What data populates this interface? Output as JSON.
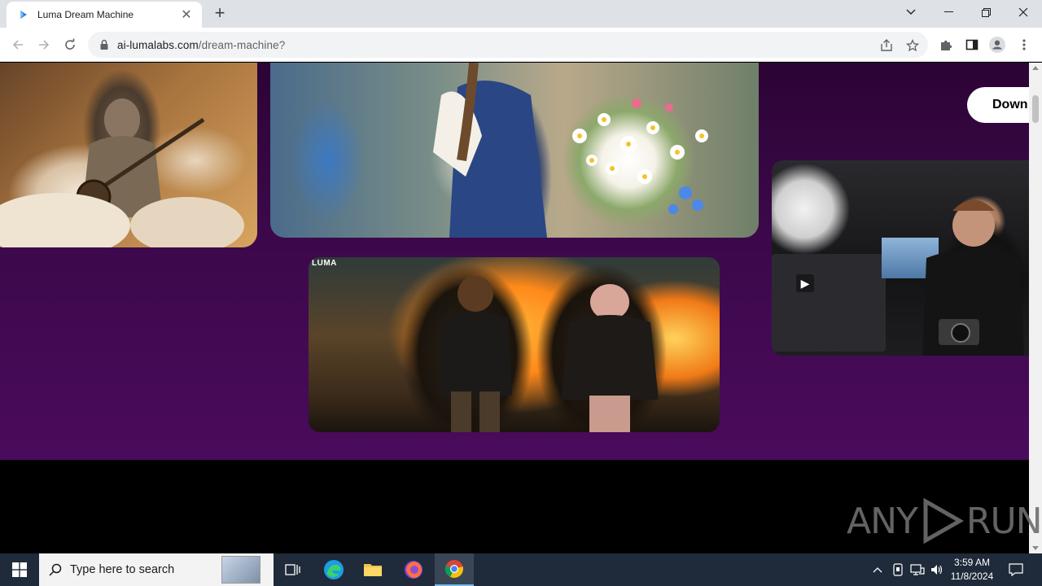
{
  "browser": {
    "tab_title": "Luma Dream Machine",
    "url_domain": "ai-lumalabs.com",
    "url_path": "/dream-machine?"
  },
  "page": {
    "download_label": "Down",
    "fire_card_brand": "LUMA",
    "watermark_left": "ANY",
    "watermark_right": "RUN"
  },
  "taskbar": {
    "search_placeholder": "Type here to search",
    "time": "3:59 AM",
    "date": "11/8/2024"
  },
  "colors": {
    "page_purple": "#3b0849",
    "tabbar": "#dee1e6",
    "taskbar": "#1f2b3a"
  }
}
